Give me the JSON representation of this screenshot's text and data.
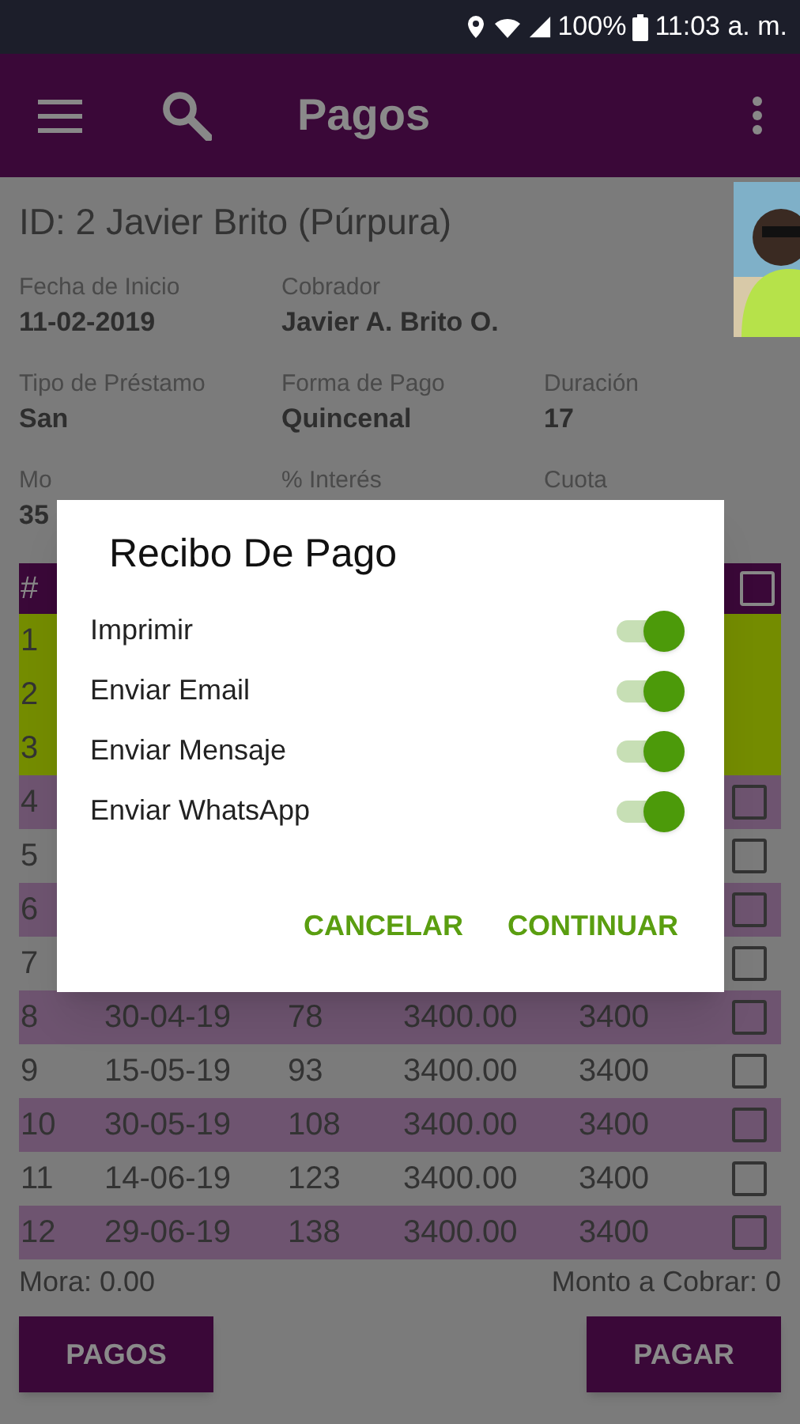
{
  "status_bar": {
    "battery": "100%",
    "time": "11:03 a. m."
  },
  "app_bar": {
    "title": "Pagos"
  },
  "client": {
    "title": "ID: 2  Javier Brito (Púrpura)"
  },
  "fields": [
    [
      {
        "label": "Fecha de Inicio",
        "value": "11-02-2019"
      },
      {
        "label": "Cobrador",
        "value": "Javier A. Brito O."
      }
    ],
    [
      {
        "label": "Tipo de Préstamo",
        "value": "San"
      },
      {
        "label": "Forma de Pago",
        "value": "Quincenal"
      },
      {
        "label": "Duración",
        "value": "17"
      }
    ],
    [
      {
        "label": "Mo",
        "value": "35"
      },
      {
        "label": "% Interés"
      },
      {
        "label": "Cuota"
      }
    ]
  ],
  "table": {
    "header": {
      "column_1": "#",
      "checked": false
    },
    "rows": [
      {
        "kind": "paid",
        "color": "#748c00",
        "cells": [
          "1"
        ]
      },
      {
        "kind": "paid",
        "color": "#748c00",
        "cells": [
          "2"
        ]
      },
      {
        "kind": "paid",
        "color": "#748c00",
        "cells": [
          "3"
        ]
      },
      {
        "kind": "open",
        "color": "#6e5470",
        "checked": false,
        "cells": [
          "4"
        ]
      },
      {
        "kind": "open",
        "color": "#7b7b7b",
        "checked": false,
        "cells": [
          "5"
        ]
      },
      {
        "kind": "open",
        "color": "#6e5470",
        "checked": false,
        "cells": [
          "6"
        ]
      },
      {
        "kind": "open",
        "color": "#7b7b7b",
        "checked": false,
        "cells": [
          "7"
        ]
      },
      {
        "kind": "open",
        "color": "#6e5470",
        "checked": false,
        "cells": [
          "8",
          "30-04-19",
          "78",
          "3400.00",
          "3400"
        ]
      },
      {
        "kind": "open",
        "color": "#7b7b7b",
        "checked": false,
        "cells": [
          "9",
          "15-05-19",
          "93",
          "3400.00",
          "3400"
        ]
      },
      {
        "kind": "open",
        "color": "#6e5470",
        "checked": false,
        "cells": [
          "10",
          "30-05-19",
          "108",
          "3400.00",
          "3400"
        ]
      },
      {
        "kind": "open",
        "color": "#7b7b7b",
        "checked": false,
        "cells": [
          "11",
          "14-06-19",
          "123",
          "3400.00",
          "3400"
        ]
      },
      {
        "kind": "open",
        "color": "#6e5470",
        "checked": false,
        "cells": [
          "12",
          "29-06-19",
          "138",
          "3400.00",
          "3400"
        ]
      }
    ]
  },
  "footer": {
    "mora": "Mora:  0.00",
    "monto": "Monto a Cobrar:  0",
    "buttons": [
      "PAGOS",
      "PAGAR"
    ]
  },
  "dialog": {
    "title": "Recibo De Pago",
    "options": [
      {
        "label": "Imprimir",
        "on": true
      },
      {
        "label": "Enviar Email",
        "on": true
      },
      {
        "label": "Enviar Mensaje",
        "on": true
      },
      {
        "label": "Enviar WhatsApp",
        "on": true
      }
    ],
    "buttons": [
      "CANCELAR",
      "CONTINUAR"
    ]
  }
}
